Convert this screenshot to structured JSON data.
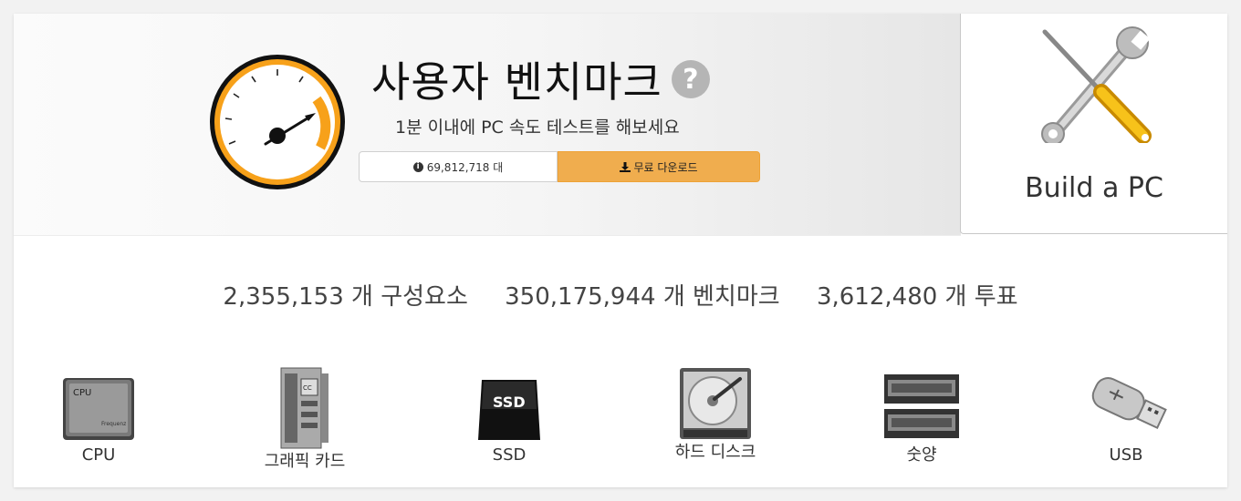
{
  "hero": {
    "title": "사용자 벤치마크",
    "help": "?",
    "subtitle": "1분 이내에 PC 속도 테스트를 해보세요",
    "downloads_count": "69,812,718 대",
    "download_label": "무료 다운로드"
  },
  "build": {
    "label": "Build a PC"
  },
  "stats": {
    "components": "2,355,153 개 구성요소",
    "benchmarks": "350,175,944 개 벤치마크",
    "votes": "3,612,480 개 투표"
  },
  "categories": [
    {
      "label": "CPU",
      "icon": "cpu-icon",
      "chip_text": "CPU",
      "chip_sub": "Frequenz"
    },
    {
      "label": "그래픽 카드",
      "icon": "graphics-card-icon",
      "chip_text": "CC"
    },
    {
      "label": "SSD",
      "icon": "ssd-icon",
      "chip_text": "SSD"
    },
    {
      "label": "하드 디스크",
      "icon": "hard-disk-icon"
    },
    {
      "label": "숫양",
      "icon": "ram-icon"
    },
    {
      "label": "USB",
      "icon": "usb-icon"
    }
  ],
  "colors": {
    "accent": "#f0ad4e",
    "gauge_orange": "#f7a11a"
  }
}
